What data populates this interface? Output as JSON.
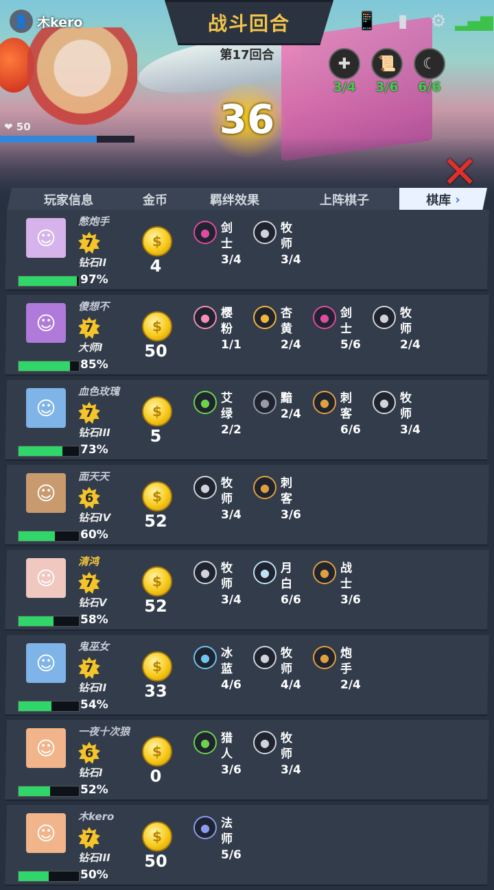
{
  "header": {
    "player_name": "木kero",
    "title": "战斗回合",
    "round": "第17回合",
    "countdown": "36",
    "hp": "50",
    "synergy_summary": [
      {
        "icon": "cross-icon",
        "count": "3/4"
      },
      {
        "icon": "scroll-icon",
        "count": "3/6"
      },
      {
        "icon": "moon-icon",
        "count": "6/6"
      }
    ]
  },
  "tabs": [
    "玩家信息",
    "金币",
    "羁绊效果",
    "上阵棋子",
    "棋库"
  ],
  "players": [
    {
      "name": "憋炮手",
      "level": "7",
      "rank": "钻石II",
      "progress": 97,
      "progress_label": "97%",
      "gold": "4",
      "avatar_color": "#d6b3ea",
      "name_color": "normal",
      "synergies": [
        {
          "icon": "sword-icon",
          "color": "#e04aa0",
          "name": "剑士",
          "count": "3/4"
        },
        {
          "icon": "cross-icon",
          "color": "#d0d4da",
          "name": "牧师",
          "count": "3/4"
        }
      ]
    },
    {
      "name": "傻想不",
      "level": "7",
      "rank": "大师I",
      "progress": 85,
      "progress_label": "85%",
      "gold": "50",
      "avatar_color": "#b07adb",
      "name_color": "normal",
      "synergies": [
        {
          "icon": "sakura-icon",
          "color": "#f28fb6",
          "name": "樱粉",
          "count": "1/1"
        },
        {
          "icon": "lotus-icon",
          "color": "#f2b63a",
          "name": "杏黄",
          "count": "2/4"
        },
        {
          "icon": "sword-icon",
          "color": "#e04aa0",
          "name": "剑士",
          "count": "5/6"
        },
        {
          "icon": "cross-icon",
          "color": "#d0d4da",
          "name": "牧师",
          "count": "2/4"
        }
      ]
    },
    {
      "name": "血色玫瑰",
      "level": "7",
      "rank": "钻石III",
      "progress": 73,
      "progress_label": "73%",
      "gold": "5",
      "avatar_color": "#7fb4e8",
      "name_color": "normal",
      "synergies": [
        {
          "icon": "leaf-icon",
          "color": "#6cd44a",
          "name": "艾绿",
          "count": "2/2"
        },
        {
          "icon": "eye-icon",
          "color": "#9a9aa8",
          "name": "黯",
          "count": "2/4"
        },
        {
          "icon": "assassin-icon",
          "color": "#e0a040",
          "name": "刺客",
          "count": "6/6"
        },
        {
          "icon": "cross-icon",
          "color": "#d0d4da",
          "name": "牧师",
          "count": "3/4"
        }
      ]
    },
    {
      "name": "面天天",
      "level": "6",
      "rank": "钻石IV",
      "progress": 60,
      "progress_label": "60%",
      "gold": "52",
      "avatar_color": "#c99a6e",
      "name_color": "normal",
      "synergies": [
        {
          "icon": "cross-icon",
          "color": "#d0d4da",
          "name": "牧师",
          "count": "3/4"
        },
        {
          "icon": "assassin-icon",
          "color": "#e0a040",
          "name": "刺客",
          "count": "3/6"
        }
      ]
    },
    {
      "name": "清鸿",
      "level": "7",
      "rank": "钻石V",
      "progress": 58,
      "progress_label": "58%",
      "gold": "52",
      "avatar_color": "#f0c8c0",
      "name_color": "gold",
      "synergies": [
        {
          "icon": "cross-icon",
          "color": "#d0d4da",
          "name": "牧师",
          "count": "3/4"
        },
        {
          "icon": "moon-icon",
          "color": "#bfe3f5",
          "name": "月白",
          "count": "6/6"
        },
        {
          "icon": "warrior-icon",
          "color": "#e0a040",
          "name": "战士",
          "count": "3/6"
        }
      ]
    },
    {
      "name": "鬼巫女",
      "level": "7",
      "rank": "钻石II",
      "progress": 54,
      "progress_label": "54%",
      "gold": "33",
      "avatar_color": "#7fb4e8",
      "name_color": "normal",
      "synergies": [
        {
          "icon": "snowflake-icon",
          "color": "#6fc4f0",
          "name": "冰蓝",
          "count": "4/6"
        },
        {
          "icon": "cross-icon",
          "color": "#d0d4da",
          "name": "牧师",
          "count": "4/4"
        },
        {
          "icon": "cannon-icon",
          "color": "#e0a040",
          "name": "炮手",
          "count": "2/4"
        }
      ]
    },
    {
      "name": "一夜十次狼",
      "level": "6",
      "rank": "钻石I",
      "progress": 52,
      "progress_label": "52%",
      "gold": "0",
      "avatar_color": "#f2b48a",
      "name_color": "normal",
      "synergies": [
        {
          "icon": "bow-icon",
          "color": "#6cd44a",
          "name": "猎人",
          "count": "3/6"
        },
        {
          "icon": "cross-icon",
          "color": "#d0d4da",
          "name": "牧师",
          "count": "3/4"
        }
      ]
    },
    {
      "name": "木kero",
      "level": "7",
      "rank": "钻石III",
      "progress": 50,
      "progress_label": "50%",
      "gold": "50",
      "avatar_color": "#f2b48a",
      "name_color": "normal",
      "synergies": [
        {
          "icon": "mage-icon",
          "color": "#8a9cf0",
          "name": "法师",
          "count": "5/6"
        }
      ]
    }
  ]
}
